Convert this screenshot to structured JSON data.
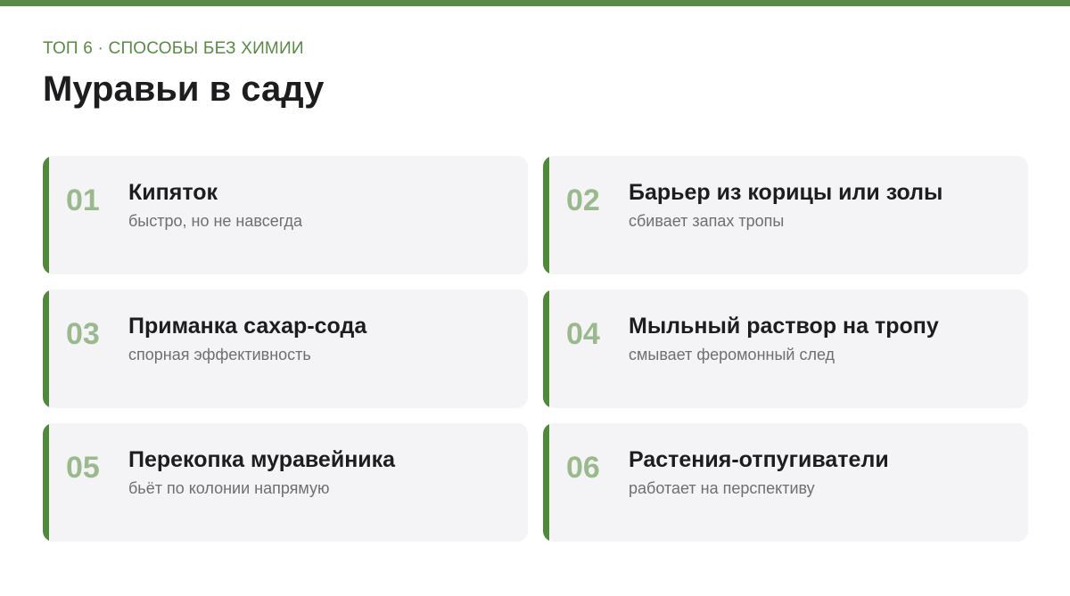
{
  "header": {
    "kicker": "ТОП 6 · СПОСОБЫ БЕЗ ХИМИИ",
    "title": "Муравьи в саду"
  },
  "colors": {
    "accent": "#5a8a46",
    "number": "#9ab98c",
    "card_bg": "#f4f4f6",
    "title_text": "#1d1d1f",
    "desc_text": "#6e6e73"
  },
  "items": [
    {
      "num": "01",
      "name": "Кипяток",
      "desc": "быстро, но не навсегда"
    },
    {
      "num": "02",
      "name": "Барьер из корицы или золы",
      "desc": "сбивает запах тропы"
    },
    {
      "num": "03",
      "name": "Приманка сахар-сода",
      "desc": "спорная эффективность"
    },
    {
      "num": "04",
      "name": "Мыльный раствор на тропу",
      "desc": "смывает феромонный след"
    },
    {
      "num": "05",
      "name": "Перекопка муравейника",
      "desc": "бьёт по колонии напрямую"
    },
    {
      "num": "06",
      "name": "Растения-отпугиватели",
      "desc": "работает на перспективу"
    }
  ]
}
